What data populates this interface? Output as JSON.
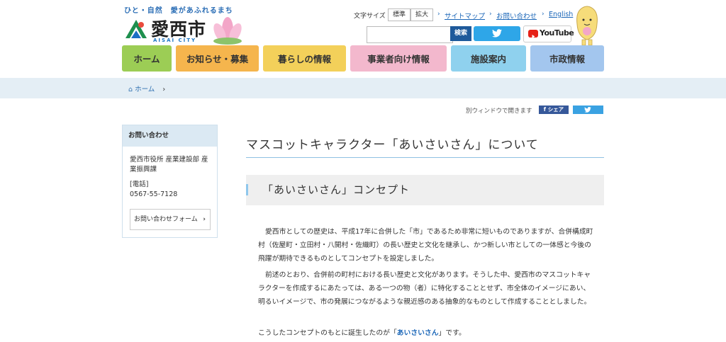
{
  "header": {
    "tagline": "ひと・自然　愛があふれるまち",
    "logo_text": "愛西市",
    "logo_sub": "AISAI CITY",
    "font_size_label": "文字サイズ",
    "font_size_standard": "標準",
    "font_size_large": "拡大",
    "links": [
      "サイトマップ",
      "お問い合わせ",
      "English"
    ],
    "search_placeholder": "",
    "search_button": "検索",
    "youtube_label": "YouTube"
  },
  "nav": [
    {
      "label": "ホーム",
      "color": "#9ccd55"
    },
    {
      "label": "お知らせ・募集",
      "color": "#f5b54d"
    },
    {
      "label": "暮らしの情報",
      "color": "#f3d05a"
    },
    {
      "label": "事業者向け情報",
      "color": "#f3b8cd"
    },
    {
      "label": "施設案内",
      "color": "#8fd1ee"
    },
    {
      "label": "市政情報",
      "color": "#a3c6ee"
    }
  ],
  "breadcrumb": {
    "home": "ホーム"
  },
  "share": {
    "label": "別ウィンドウで開きます",
    "facebook": "シェア"
  },
  "sidebar": {
    "heading": "お問い合わせ",
    "dept_line1": "愛西市役所 産業建設部 産",
    "dept_line2": "業振興課",
    "phone_label": "[電話]",
    "phone": "0567-55-7128",
    "form_link": "お問い合わせフォーム"
  },
  "main": {
    "title": "マスコットキャラクター「あいさいさん」について",
    "section_heading": "「あいさいさん」コンセプト",
    "para1": "愛西市としての歴史は、平成17年に合併した「市」であるため非常に短いものでありますが、合併構成町村（佐屋町・立田村・八開村・佐織町）の長い歴史と文化を継承し、かつ新しい市としての一体感と今後の飛躍が期待できるものとしてコンセプトを設定しました。",
    "para2": "前述のとおり、合併前の町村における長い歴史と文化があります。そうした中、愛西市のマスコットキャラクターを作成するにあたっては、ある一つの物（者）に特化することとせず、市全体のイメージにあい、明るいイメージで、市の発展につながるような親近感のある抽象的なものとして作成することとしました。",
    "para3_prefix": "こうしたコンセプトのもとに誕生したのが「",
    "para3_link": "あいさいさん",
    "para3_suffix": "」です。"
  }
}
